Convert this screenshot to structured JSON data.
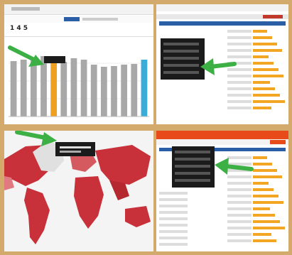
{
  "panels": [
    {
      "id": "bar-chart-screenshot",
      "header_number": "1 4 5",
      "tooltip_text": "",
      "chart_data": {
        "type": "bar",
        "categories": [
          "",
          "",
          "",
          "",
          "",
          "",
          "",
          "",
          "",
          "",
          "",
          "",
          "",
          ""
        ],
        "values": [
          78,
          80,
          79,
          85,
          80,
          77,
          82,
          80,
          73,
          70,
          71,
          73,
          74,
          80
        ],
        "highlight_index": 4,
        "colors": {
          "default": "#a8a8a8",
          "highlight": "#f0a020",
          "last": "#3aacd8"
        },
        "title": "",
        "xlabel": "",
        "ylabel": ""
      }
    },
    {
      "id": "list-screenshot",
      "tooltip_text": ""
    },
    {
      "id": "world-map-screenshot",
      "tooltip_text": "",
      "map_color": "#c8303a"
    },
    {
      "id": "orange-app-screenshot",
      "header_color": "#e84a1a",
      "tooltip_text": ""
    }
  ],
  "colors": {
    "frame": "#d4aa6c",
    "arrow": "#3cb044",
    "tooltip": "#1b1b1b",
    "accent_blue": "#2a5fa8",
    "bar_orange": "#f2a623"
  },
  "icons": [
    "pointer-arrow-icon"
  ]
}
